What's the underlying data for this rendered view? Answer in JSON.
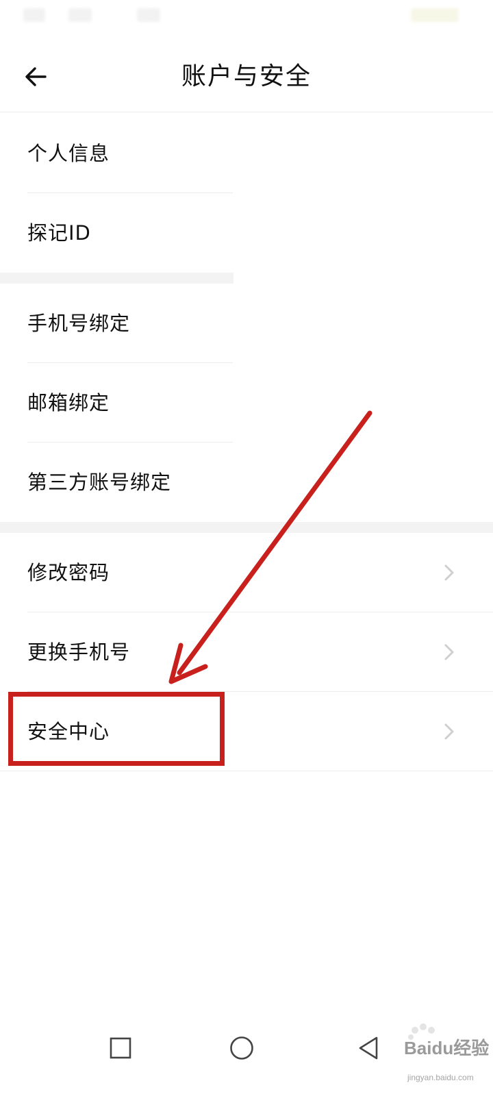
{
  "header": {
    "title": "账户与安全",
    "back_icon": "arrow-left-icon"
  },
  "sections": [
    {
      "items": [
        {
          "label": "个人信息"
        },
        {
          "label": "探记ID"
        }
      ]
    },
    {
      "items": [
        {
          "label": "手机号绑定"
        },
        {
          "label": "邮箱绑定"
        },
        {
          "label": "第三方账号绑定"
        }
      ]
    },
    {
      "items": [
        {
          "label": "修改密码",
          "icon": "chevron-right-icon"
        },
        {
          "label": "更换手机号",
          "icon": "chevron-right-icon"
        },
        {
          "label": "安全中心",
          "icon": "chevron-right-icon"
        }
      ]
    }
  ],
  "annotation": {
    "color": "#c8201c",
    "target": "安全中心"
  },
  "nav_bar": {
    "items": [
      "square-icon",
      "circle-icon",
      "triangle-back-icon"
    ]
  },
  "watermark": {
    "text": "Baidu经验",
    "sub": "jingyan.baidu.com"
  },
  "colors": {
    "divider": "#ececec",
    "section_gap": "#f3f3f3",
    "chevron": "#cfcfcf",
    "text": "#111111"
  }
}
